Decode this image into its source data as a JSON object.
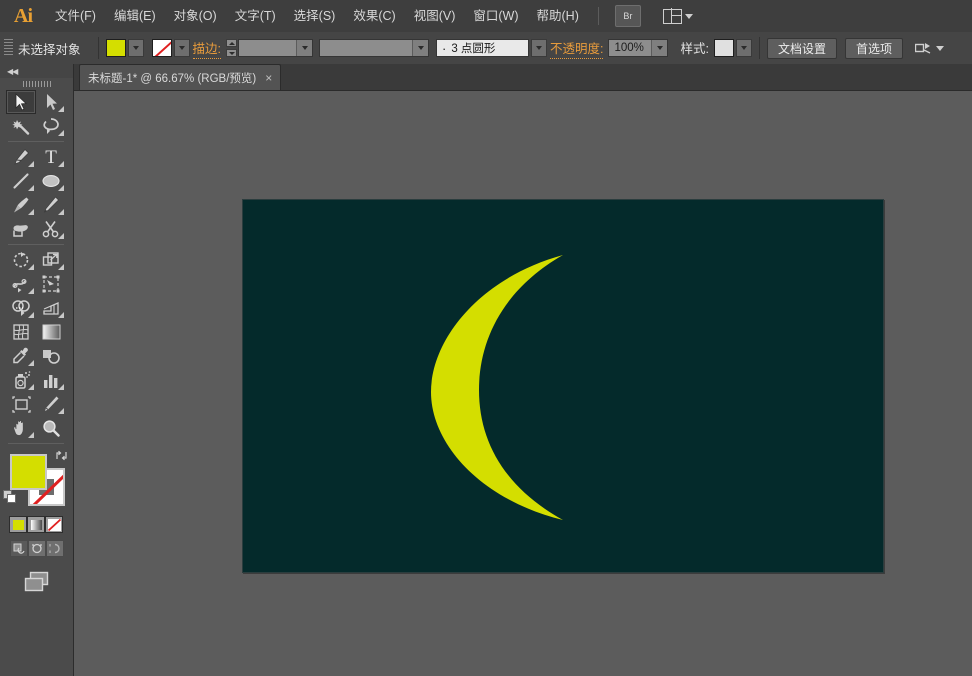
{
  "app": {
    "name": "Ai",
    "logo_text": "Ai"
  },
  "menubar": {
    "items": [
      {
        "label": "文件(F)",
        "name": "menu-file"
      },
      {
        "label": "编辑(E)",
        "name": "menu-edit"
      },
      {
        "label": "对象(O)",
        "name": "menu-object"
      },
      {
        "label": "文字(T)",
        "name": "menu-type"
      },
      {
        "label": "选择(S)",
        "name": "menu-select"
      },
      {
        "label": "效果(C)",
        "name": "menu-effect"
      },
      {
        "label": "视图(V)",
        "name": "menu-view"
      },
      {
        "label": "窗口(W)",
        "name": "menu-window"
      },
      {
        "label": "帮助(H)",
        "name": "menu-help"
      }
    ],
    "bridge_label": "Br",
    "arrange_icon": "arrange-documents-icon"
  },
  "controlbar": {
    "selection_status": "未选择对象",
    "fill_color": "#d4de00",
    "fill_icon": "fill-swatch",
    "stroke_color": "none",
    "stroke_icon": "stroke-swatch-none",
    "stroke_label": "描边:",
    "stroke_weight": "",
    "stroke_profile": "",
    "brush_value": "3 点圆形",
    "opacity_label": "不透明度:",
    "opacity_value": "100%",
    "style_label": "样式:",
    "doc_setup_label": "文档设置",
    "preferences_label": "首选项"
  },
  "tabbar": {
    "tab_title": "未标题-1* @ 66.67% (RGB/预览)",
    "close_glyph": "×"
  },
  "toolpanel": {
    "collapse_glyph": "◀◀",
    "tools": [
      {
        "name": "selection-tool",
        "active": true,
        "flyout": false
      },
      {
        "name": "direct-selection-tool",
        "active": false,
        "flyout": true
      },
      {
        "name": "magic-wand-tool",
        "active": false,
        "flyout": false
      },
      {
        "name": "lasso-tool",
        "active": false,
        "flyout": false
      },
      {
        "name": "pen-tool",
        "active": false,
        "flyout": true
      },
      {
        "name": "type-tool",
        "active": false,
        "flyout": true
      },
      {
        "name": "line-segment-tool",
        "active": false,
        "flyout": true
      },
      {
        "name": "ellipse-tool",
        "active": false,
        "flyout": true
      },
      {
        "name": "paintbrush-tool",
        "active": false,
        "flyout": true
      },
      {
        "name": "pencil-tool",
        "active": false,
        "flyout": true
      },
      {
        "name": "blob-brush-tool",
        "active": false,
        "flyout": false
      },
      {
        "name": "eraser-tool",
        "active": false,
        "flyout": true
      },
      {
        "name": "rotate-tool",
        "active": false,
        "flyout": true
      },
      {
        "name": "scale-tool",
        "active": false,
        "flyout": true
      },
      {
        "name": "width-tool",
        "active": false,
        "flyout": true
      },
      {
        "name": "free-transform-tool",
        "active": false,
        "flyout": false
      },
      {
        "name": "shape-builder-tool",
        "active": false,
        "flyout": true
      },
      {
        "name": "perspective-grid-tool",
        "active": false,
        "flyout": true
      },
      {
        "name": "mesh-tool",
        "active": false,
        "flyout": false
      },
      {
        "name": "gradient-tool",
        "active": false,
        "flyout": false
      },
      {
        "name": "eyedropper-tool",
        "active": false,
        "flyout": true
      },
      {
        "name": "blend-tool",
        "active": false,
        "flyout": false
      },
      {
        "name": "symbol-sprayer-tool",
        "active": false,
        "flyout": true
      },
      {
        "name": "column-graph-tool",
        "active": false,
        "flyout": true
      },
      {
        "name": "artboard-tool",
        "active": false,
        "flyout": false
      },
      {
        "name": "slice-tool",
        "active": false,
        "flyout": true
      },
      {
        "name": "hand-tool",
        "active": false,
        "flyout": true
      },
      {
        "name": "zoom-tool",
        "active": false,
        "flyout": false
      }
    ],
    "fill_color": "#d4de00",
    "stroke_color": "none",
    "swap_icon": "swap-fill-stroke-icon",
    "default_icon": "default-fill-stroke-icon",
    "color_mode_buttons": [
      "color-swatch-button",
      "gradient-button",
      "none-button"
    ],
    "draw_mode_buttons": [
      "draw-normal-button",
      "draw-behind-button",
      "draw-inside-button"
    ],
    "screen_mode_icon": "change-screen-mode-icon"
  },
  "canvas": {
    "workspace_color": "#5c5c5c",
    "artboard": {
      "background_color": "#042a2b",
      "artwork": {
        "name": "crescent-moon-shape",
        "fill_color": "#d4de00"
      }
    }
  }
}
